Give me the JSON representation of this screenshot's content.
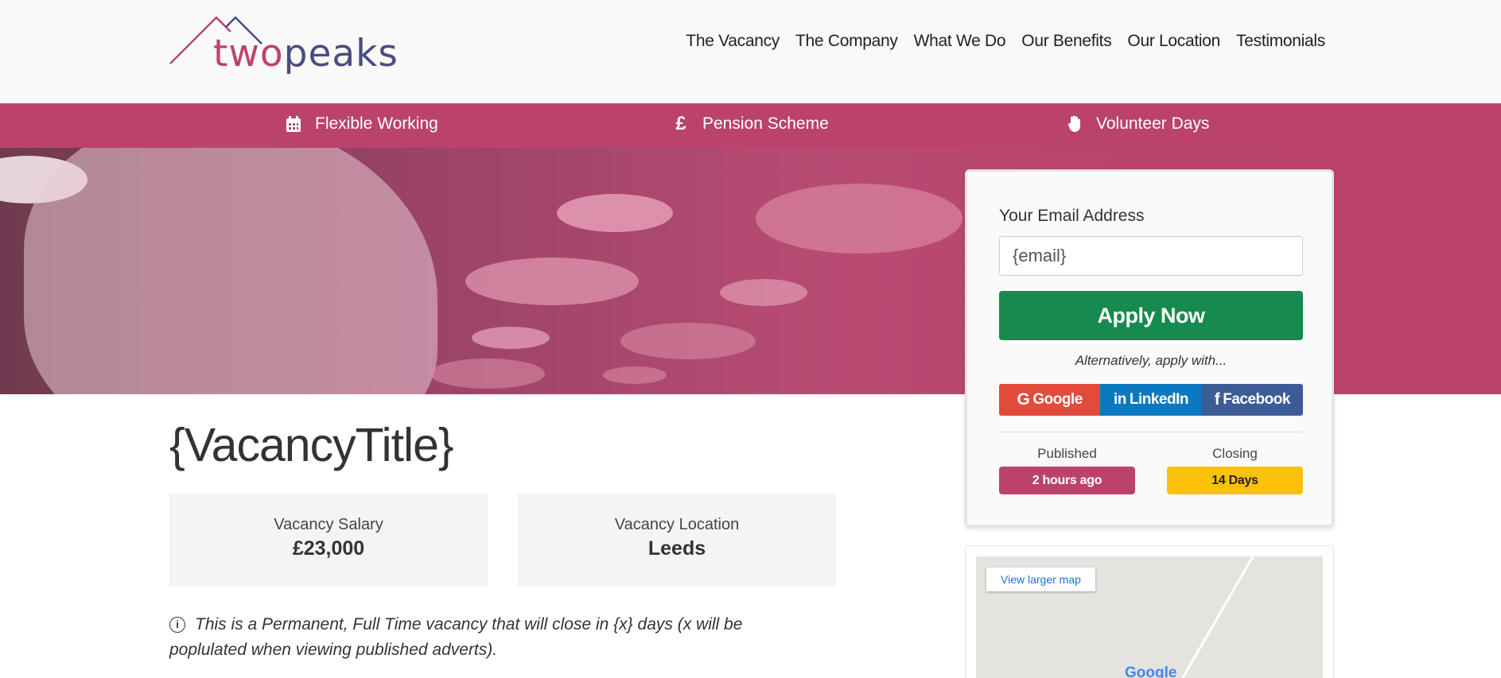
{
  "brand": {
    "logo_part1": "two",
    "logo_part2": "peaks"
  },
  "nav": [
    {
      "label": "The Vacancy"
    },
    {
      "label": "The Company"
    },
    {
      "label": "What We Do"
    },
    {
      "label": "Our Benefits"
    },
    {
      "label": "Our Location"
    },
    {
      "label": "Testimonials"
    }
  ],
  "benefits": [
    {
      "icon": "calendar-icon",
      "label": "Flexible Working"
    },
    {
      "icon": "pound-icon",
      "label": "Pension Scheme"
    },
    {
      "icon": "hand-icon",
      "label": "Volunteer Days"
    }
  ],
  "apply": {
    "email_label": "Your Email Address",
    "email_value": "{email}",
    "apply_button": "Apply Now",
    "alternative_text": "Alternatively, apply with...",
    "social": {
      "google": "Google",
      "linkedin": "LinkedIn",
      "facebook": "Facebook"
    },
    "published_label": "Published",
    "published_value": "2 hours ago",
    "closing_label": "Closing",
    "closing_value": "14 Days"
  },
  "map": {
    "link": "View larger map",
    "google": "Google"
  },
  "vacancy": {
    "title": "{VacancyTitle}",
    "salary_label": "Vacancy Salary",
    "salary_value": "£23,000",
    "location_label": "Vacancy Location",
    "location_value": "Leeds",
    "note": "This is a Permanent, Full Time vacancy that will close in {x} days (x will be poplulated when viewing published adverts)."
  },
  "colors": {
    "brand_pink": "#bb426d",
    "brand_navy": "#4b4c80",
    "apply_green": "#168a4f",
    "closing_yellow": "#fcc10b"
  }
}
